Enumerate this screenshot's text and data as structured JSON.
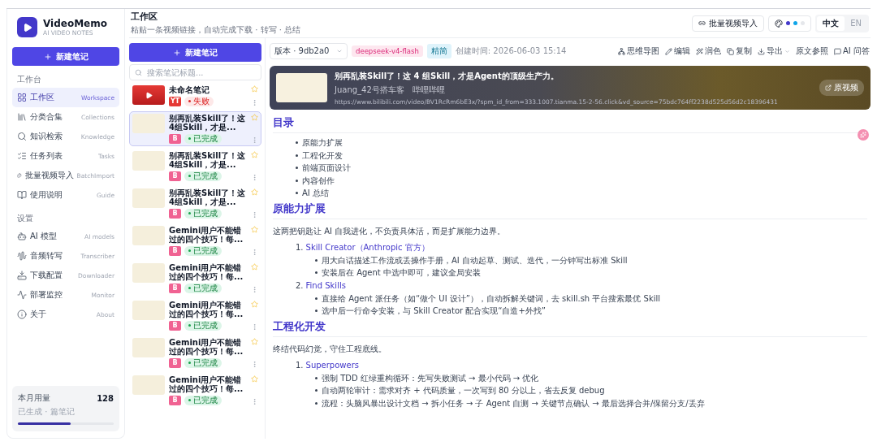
{
  "app": {
    "name": "VideoMemo",
    "tagline": "AI VIDEO NOTES"
  },
  "sidebar": {
    "new_note": "新建笔记",
    "sections": [
      {
        "title": "工作台",
        "items": [
          {
            "label": "工作区",
            "hint": "Workspace",
            "selected": true
          },
          {
            "label": "分类合集",
            "hint": "Collections",
            "selected": false
          },
          {
            "label": "知识检索",
            "hint": "Knowledge",
            "selected": false
          },
          {
            "label": "任务列表",
            "hint": "Tasks",
            "selected": false
          },
          {
            "label": "批量视频导入",
            "hint": "BatchImport",
            "selected": false
          },
          {
            "label": "使用说明",
            "hint": "Guide",
            "selected": false
          }
        ]
      },
      {
        "title": "设置",
        "items": [
          {
            "label": "AI 模型",
            "hint": "AI models",
            "selected": false
          },
          {
            "label": "音频转写",
            "hint": "Transcriber",
            "selected": false
          },
          {
            "label": "下载配置",
            "hint": "Downloader",
            "selected": false
          },
          {
            "label": "部署监控",
            "hint": "Monitor",
            "selected": false
          },
          {
            "label": "关于",
            "hint": "About",
            "selected": false
          }
        ]
      }
    ],
    "usage": {
      "label": "本月用量",
      "count": "128",
      "caption": "已生成 · 篇笔记",
      "level": 0.55
    }
  },
  "header": {
    "title": "工作区",
    "subtitle": "粘贴一条视频链接，自动完成下载 · 转写 · 总结",
    "batch_import": "批量视频导入",
    "languages": [
      {
        "label": "中文",
        "selected": true
      },
      {
        "label": "EN",
        "selected": false
      }
    ]
  },
  "notes": {
    "new_note": "新建笔记",
    "search_placeholder": "搜索笔记标题...",
    "items": [
      {
        "title": "未命名笔记",
        "kind": "youtube",
        "source": "YT",
        "status": "失败",
        "failed": true,
        "selected": false
      },
      {
        "title": "别再乱装Skill了！这4组Skill，才是...",
        "kind": "bilibili",
        "source": "B",
        "status": "已完成",
        "failed": false,
        "selected": true
      },
      {
        "title": "别再乱装Skill了！这4组Skill，才是...",
        "kind": "bilibili",
        "source": "B",
        "status": "已完成",
        "failed": false,
        "selected": false
      },
      {
        "title": "别再乱装Skill了！这4组Skill，才是...",
        "kind": "bilibili",
        "source": "B",
        "status": "已完成",
        "failed": false,
        "selected": false
      },
      {
        "title": "Gemini用户不能错过的四个技巧！每...",
        "kind": "bilibili",
        "source": "B",
        "status": "已完成",
        "failed": false,
        "selected": false
      },
      {
        "title": "Gemini用户不能错过的四个技巧！每...",
        "kind": "bilibili",
        "source": "B",
        "status": "已完成",
        "failed": false,
        "selected": false
      },
      {
        "title": "Gemini用户不能错过的四个技巧！每...",
        "kind": "bilibili",
        "source": "B",
        "status": "已完成",
        "failed": false,
        "selected": false
      },
      {
        "title": "Gemini用户不能错过的四个技巧！每...",
        "kind": "bilibili",
        "source": "B",
        "status": "已完成",
        "failed": false,
        "selected": false
      },
      {
        "title": "Gemini用户不能错过的四个技巧！每...",
        "kind": "bilibili",
        "source": "B",
        "status": "已完成",
        "failed": false,
        "selected": false
      }
    ]
  },
  "toolbar": {
    "version": "版本 · 9db2a0",
    "model": "deepseek-v4-flash",
    "mode": "精简",
    "created": "创建时间: 2026-06-03 15:14",
    "actions": [
      {
        "label": "思维导图",
        "menu": false
      },
      {
        "label": "编辑",
        "menu": false
      },
      {
        "label": "润色",
        "menu": false
      },
      {
        "label": "复制",
        "menu": false
      },
      {
        "label": "导出",
        "menu": true
      },
      {
        "label": "原文参照",
        "menu": false
      },
      {
        "label": "AI 问答",
        "menu": false
      }
    ]
  },
  "video": {
    "title": "别再乱装Skill了！这 4 组Skill，才是Agent的顶级生产力。",
    "author": "Juang_42号搭车客",
    "platform": "哔哩哔哩",
    "url": "https://www.bilibili.com/video/BV1RcRm6bE3x/?spm_id_from=333.1007.tianma.15-2-56.click&vd_source=75bdc764ff2238d525d56d2c18396431",
    "open": "原视频"
  },
  "document": [
    {
      "kind": "h2",
      "text": "目录"
    },
    {
      "kind": "ul",
      "items": [
        "原能力扩展",
        "工程化开发",
        "前端页面设计",
        "内容创作",
        "AI 总结"
      ]
    },
    {
      "kind": "h2",
      "text": "原能力扩展"
    },
    {
      "kind": "p",
      "text": "这两把钥匙让 AI 自我进化，不负责具体活，而是扩展能力边界。"
    },
    {
      "kind": "ol",
      "items": [
        {
          "number": "1.",
          "title": "Skill Creator（Anthropic 官方）",
          "children": [
            "用大白话描述工作流或丢操作手册，AI 自动起草、测试、迭代，一分钟写出标准 Skill",
            "安装后在 Agent 中选中即可，建议全局安装"
          ]
        },
        {
          "number": "2.",
          "title": "Find Skills",
          "children": [
            "直接给 Agent 派任务（如“做个 UI 设计”），自动拆解关键词，去 skill.sh 平台搜索最优 Skill",
            "选中后一行命令安装，与 Skill Creator 配合实现“自造+外找”"
          ]
        }
      ]
    },
    {
      "kind": "h2",
      "text": "工程化开发"
    },
    {
      "kind": "p",
      "text": "终结代码幻觉，守住工程底线。"
    },
    {
      "kind": "ol",
      "items": [
        {
          "number": "1.",
          "title": "Superpowers",
          "children": [
            "强制 TDD 红绿重构循环：先写失败测试 → 最小代码 → 优化",
            "自动两轮审计：需求对齐 + 代码质量，一次写到 80 分以上，省去反复 debug",
            "流程：头脑风暴出设计文档 → 拆小任务 → 子 Agent 自测 → 关键节点确认 → 最后选择合并/保留分支/丢弃"
          ]
        }
      ]
    }
  ]
}
